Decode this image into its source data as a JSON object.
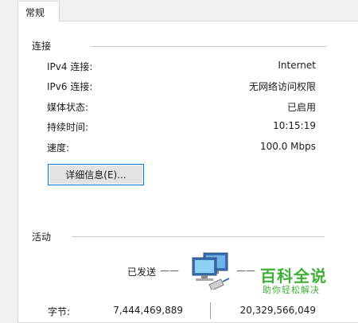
{
  "tab": {
    "label": "常规"
  },
  "connection": {
    "title": "连接",
    "rows": [
      {
        "label": "IPv4 连接:",
        "value": "Internet"
      },
      {
        "label": "IPv6 连接:",
        "value": "无网络访问权限"
      },
      {
        "label": "媒体状态:",
        "value": "已启用"
      },
      {
        "label": "持续时间:",
        "value": "10:15:19"
      },
      {
        "label": "速度:",
        "value": "100.0 Mbps"
      }
    ],
    "details_button": "详细信息(E)..."
  },
  "activity": {
    "title": "活动",
    "sent_label": "已发送",
    "sent_dash": "——",
    "received_dash": "——",
    "bytes_label": "字节:",
    "sent_bytes": "7,444,469,889",
    "received_bytes": "20,329,566,049"
  },
  "watermark": {
    "title": "百科全说",
    "subtitle": "助你轻松解决"
  },
  "colors": {
    "accent": "#0078d7",
    "watermark": "#3cb034"
  },
  "icons": [
    "network-computers-icon"
  ]
}
